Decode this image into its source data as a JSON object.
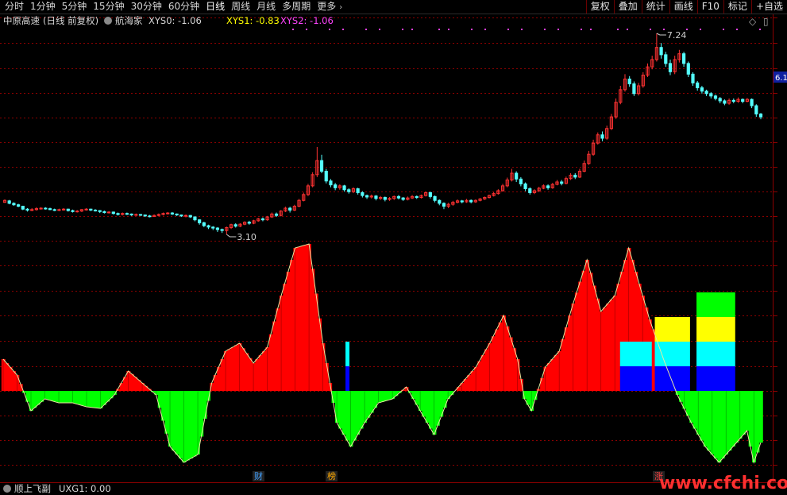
{
  "toolbar": {
    "periods": [
      {
        "label": "分时",
        "active": false
      },
      {
        "label": "1分钟",
        "active": false
      },
      {
        "label": "5分钟",
        "active": false
      },
      {
        "label": "15分钟",
        "active": false
      },
      {
        "label": "30分钟",
        "active": false
      },
      {
        "label": "60分钟",
        "active": false
      },
      {
        "label": "日线",
        "active": true
      },
      {
        "label": "周线",
        "active": false
      },
      {
        "label": "月线",
        "active": false
      },
      {
        "label": "多周期",
        "active": false
      },
      {
        "label": "更多",
        "active": false
      }
    ],
    "buttons": [
      "复权",
      "叠加",
      "统计",
      "画线",
      "F10",
      "标记",
      "+自选"
    ]
  },
  "info": {
    "stock_name": "中原高速",
    "mode": "(日线 前复权)",
    "indicator": "航海家",
    "xys0": "XYS0: -1.06",
    "xys1": "XYS1: -0.83",
    "xys2": "XYS2: -1.06"
  },
  "price_panel": {
    "high_label": "7.24",
    "low_label": "3.10",
    "right_price_tag": "6.1",
    "candles": [
      [
        3.76,
        3.8,
        3.82,
        3.75
      ],
      [
        3.79,
        3.74,
        3.81,
        3.72
      ],
      [
        3.74,
        3.71,
        3.76,
        3.69
      ],
      [
        3.71,
        3.68,
        3.73,
        3.66
      ],
      [
        3.68,
        3.62,
        3.69,
        3.6
      ],
      [
        3.62,
        3.6,
        3.64,
        3.57
      ],
      [
        3.6,
        3.61,
        3.64,
        3.58
      ],
      [
        3.61,
        3.63,
        3.66,
        3.59
      ],
      [
        3.63,
        3.64,
        3.66,
        3.61
      ],
      [
        3.64,
        3.63,
        3.66,
        3.61
      ],
      [
        3.63,
        3.61,
        3.65,
        3.6
      ],
      [
        3.61,
        3.6,
        3.63,
        3.58
      ],
      [
        3.6,
        3.61,
        3.63,
        3.58
      ],
      [
        3.61,
        3.62,
        3.64,
        3.59
      ],
      [
        3.62,
        3.59,
        3.63,
        3.57
      ],
      [
        3.59,
        3.57,
        3.61,
        3.55
      ],
      [
        3.57,
        3.58,
        3.6,
        3.55
      ],
      [
        3.58,
        3.61,
        3.62,
        3.56
      ],
      [
        3.61,
        3.62,
        3.64,
        3.59
      ],
      [
        3.62,
        3.6,
        3.63,
        3.58
      ],
      [
        3.6,
        3.59,
        3.62,
        3.57
      ],
      [
        3.59,
        3.57,
        3.6,
        3.54
      ],
      [
        3.57,
        3.55,
        3.59,
        3.53
      ],
      [
        3.55,
        3.56,
        3.58,
        3.53
      ],
      [
        3.56,
        3.53,
        3.57,
        3.51
      ],
      [
        3.53,
        3.51,
        3.55,
        3.49
      ],
      [
        3.51,
        3.53,
        3.55,
        3.49
      ],
      [
        3.53,
        3.52,
        3.55,
        3.5
      ],
      [
        3.52,
        3.5,
        3.53,
        3.48
      ],
      [
        3.5,
        3.51,
        3.53,
        3.48
      ],
      [
        3.51,
        3.5,
        3.52,
        3.48
      ],
      [
        3.5,
        3.48,
        3.51,
        3.46
      ],
      [
        3.48,
        3.47,
        3.5,
        3.45
      ],
      [
        3.47,
        3.49,
        3.51,
        3.46
      ],
      [
        3.49,
        3.51,
        3.53,
        3.47
      ],
      [
        3.51,
        3.53,
        3.55,
        3.49
      ],
      [
        3.53,
        3.54,
        3.56,
        3.51
      ],
      [
        3.54,
        3.52,
        3.56,
        3.5
      ],
      [
        3.52,
        3.5,
        3.53,
        3.48
      ],
      [
        3.5,
        3.48,
        3.51,
        3.46
      ],
      [
        3.48,
        3.49,
        3.51,
        3.45
      ],
      [
        3.49,
        3.46,
        3.5,
        3.44
      ],
      [
        3.46,
        3.4,
        3.47,
        3.37
      ],
      [
        3.4,
        3.34,
        3.41,
        3.3
      ],
      [
        3.34,
        3.28,
        3.36,
        3.25
      ],
      [
        3.28,
        3.25,
        3.3,
        3.21
      ],
      [
        3.25,
        3.23,
        3.27,
        3.19
      ],
      [
        3.23,
        3.2,
        3.25,
        3.15
      ],
      [
        3.2,
        3.18,
        3.22,
        3.13
      ],
      [
        3.18,
        3.24,
        3.26,
        3.1
      ],
      [
        3.24,
        3.3,
        3.32,
        3.21
      ],
      [
        3.3,
        3.27,
        3.33,
        3.24
      ],
      [
        3.27,
        3.31,
        3.33,
        3.25
      ],
      [
        3.31,
        3.35,
        3.37,
        3.29
      ],
      [
        3.35,
        3.33,
        3.38,
        3.3
      ],
      [
        3.33,
        3.38,
        3.4,
        3.31
      ],
      [
        3.38,
        3.42,
        3.44,
        3.36
      ],
      [
        3.42,
        3.4,
        3.45,
        3.37
      ],
      [
        3.4,
        3.46,
        3.48,
        3.38
      ],
      [
        3.46,
        3.52,
        3.55,
        3.44
      ],
      [
        3.52,
        3.49,
        3.55,
        3.46
      ],
      [
        3.49,
        3.58,
        3.6,
        3.47
      ],
      [
        3.58,
        3.64,
        3.67,
        3.56
      ],
      [
        3.64,
        3.6,
        3.67,
        3.55
      ],
      [
        3.6,
        3.68,
        3.71,
        3.58
      ],
      [
        3.68,
        3.8,
        3.83,
        3.66
      ],
      [
        3.8,
        3.92,
        3.96,
        3.78
      ],
      [
        3.92,
        4.1,
        4.14,
        3.89
      ],
      [
        4.1,
        4.33,
        4.38,
        4.07
      ],
      [
        4.33,
        4.62,
        4.9,
        4.28
      ],
      [
        4.62,
        4.4,
        4.74,
        4.36
      ],
      [
        4.4,
        4.2,
        4.45,
        4.15
      ],
      [
        4.2,
        4.12,
        4.24,
        4.07
      ],
      [
        4.12,
        4.06,
        4.16,
        4.01
      ],
      [
        4.06,
        4.1,
        4.13,
        4.02
      ],
      [
        4.1,
        4.02,
        4.12,
        3.98
      ],
      [
        4.02,
        3.98,
        4.05,
        3.94
      ],
      [
        3.98,
        4.04,
        4.07,
        3.95
      ],
      [
        4.04,
        3.96,
        4.06,
        3.92
      ],
      [
        3.96,
        3.9,
        3.99,
        3.86
      ],
      [
        3.9,
        3.87,
        3.92,
        3.83
      ],
      [
        3.87,
        3.89,
        3.92,
        3.84
      ],
      [
        3.89,
        3.84,
        3.91,
        3.8
      ],
      [
        3.84,
        3.86,
        3.89,
        3.81
      ],
      [
        3.86,
        3.82,
        3.88,
        3.78
      ],
      [
        3.82,
        3.84,
        3.87,
        3.79
      ],
      [
        3.84,
        3.88,
        3.9,
        3.81
      ],
      [
        3.88,
        3.85,
        3.91,
        3.82
      ],
      [
        3.85,
        3.82,
        3.87,
        3.79
      ],
      [
        3.82,
        3.85,
        3.88,
        3.8
      ],
      [
        3.85,
        3.88,
        3.91,
        3.83
      ],
      [
        3.88,
        3.86,
        3.9,
        3.83
      ],
      [
        3.86,
        3.9,
        3.92,
        3.84
      ],
      [
        3.9,
        3.96,
        3.98,
        3.88
      ],
      [
        3.96,
        3.88,
        3.98,
        3.84
      ],
      [
        3.88,
        3.8,
        3.9,
        3.76
      ],
      [
        3.8,
        3.74,
        3.82,
        3.7
      ],
      [
        3.74,
        3.68,
        3.76,
        3.62
      ],
      [
        3.68,
        3.72,
        3.75,
        3.64
      ],
      [
        3.72,
        3.76,
        3.79,
        3.69
      ],
      [
        3.76,
        3.79,
        3.82,
        3.74
      ],
      [
        3.79,
        3.77,
        3.81,
        3.74
      ],
      [
        3.77,
        3.8,
        3.83,
        3.75
      ],
      [
        3.8,
        3.77,
        3.82,
        3.74
      ],
      [
        3.77,
        3.8,
        3.82,
        3.75
      ],
      [
        3.8,
        3.83,
        3.85,
        3.78
      ],
      [
        3.83,
        3.86,
        3.88,
        3.81
      ],
      [
        3.86,
        3.9,
        3.92,
        3.84
      ],
      [
        3.9,
        3.94,
        3.97,
        3.88
      ],
      [
        3.94,
        4.0,
        4.03,
        3.92
      ],
      [
        4.0,
        4.1,
        4.14,
        3.98
      ],
      [
        4.1,
        4.22,
        4.27,
        4.07
      ],
      [
        4.22,
        4.36,
        4.45,
        4.19
      ],
      [
        4.36,
        4.24,
        4.4,
        4.18
      ],
      [
        4.24,
        4.14,
        4.28,
        4.09
      ],
      [
        4.14,
        4.04,
        4.17,
        3.99
      ],
      [
        4.04,
        3.96,
        4.07,
        3.92
      ],
      [
        3.96,
        4.0,
        4.03,
        3.93
      ],
      [
        4.0,
        4.05,
        4.08,
        3.97
      ],
      [
        4.05,
        4.1,
        4.13,
        4.03
      ],
      [
        4.1,
        4.06,
        4.13,
        4.02
      ],
      [
        4.06,
        4.13,
        4.16,
        4.04
      ],
      [
        4.13,
        4.18,
        4.22,
        4.11
      ],
      [
        4.18,
        4.15,
        4.22,
        4.11
      ],
      [
        4.15,
        4.25,
        4.29,
        4.13
      ],
      [
        4.25,
        4.32,
        4.36,
        4.22
      ],
      [
        4.32,
        4.28,
        4.36,
        4.24
      ],
      [
        4.28,
        4.4,
        4.45,
        4.26
      ],
      [
        4.4,
        4.56,
        4.62,
        4.38
      ],
      [
        4.56,
        4.75,
        4.82,
        4.53
      ],
      [
        4.75,
        4.98,
        5.05,
        4.72
      ],
      [
        4.98,
        5.15,
        5.2,
        4.95
      ],
      [
        5.15,
        5.08,
        5.22,
        5.02
      ],
      [
        5.08,
        5.28,
        5.34,
        5.05
      ],
      [
        5.28,
        5.52,
        5.58,
        5.25
      ],
      [
        5.52,
        5.82,
        5.9,
        5.48
      ],
      [
        5.82,
        6.08,
        6.16,
        5.78
      ],
      [
        6.08,
        6.3,
        6.4,
        6.04
      ],
      [
        6.3,
        6.2,
        6.36,
        6.14
      ],
      [
        6.2,
        6.0,
        6.25,
        5.95
      ],
      [
        6.0,
        6.16,
        6.22,
        5.96
      ],
      [
        6.16,
        6.38,
        6.44,
        6.12
      ],
      [
        6.38,
        6.55,
        6.62,
        6.34
      ],
      [
        6.55,
        6.7,
        6.78,
        6.5
      ],
      [
        6.7,
        6.95,
        7.24,
        6.66
      ],
      [
        6.95,
        6.8,
        7.04,
        6.72
      ],
      [
        6.8,
        6.62,
        6.86,
        6.55
      ],
      [
        6.62,
        6.45,
        6.7,
        6.38
      ],
      [
        6.45,
        6.7,
        6.78,
        6.4
      ],
      [
        6.7,
        6.82,
        6.9,
        6.64
      ],
      [
        6.82,
        6.62,
        6.86,
        6.55
      ],
      [
        6.62,
        6.4,
        6.66,
        6.34
      ],
      [
        6.4,
        6.22,
        6.44,
        6.16
      ],
      [
        6.22,
        6.12,
        6.26,
        6.06
      ],
      [
        6.12,
        6.05,
        6.16,
        6.0
      ],
      [
        6.05,
        6.0,
        6.08,
        5.95
      ],
      [
        6.0,
        5.95,
        6.03,
        5.9
      ],
      [
        5.95,
        5.9,
        5.98,
        5.86
      ],
      [
        5.9,
        5.85,
        5.93,
        5.8
      ],
      [
        5.85,
        5.8,
        5.88,
        5.76
      ],
      [
        5.8,
        5.86,
        5.9,
        5.77
      ],
      [
        5.86,
        5.84,
        5.9,
        5.8
      ],
      [
        5.84,
        5.88,
        5.92,
        5.81
      ],
      [
        5.88,
        5.84,
        5.9,
        5.8
      ],
      [
        5.84,
        5.88,
        5.91,
        5.82
      ],
      [
        5.88,
        5.75,
        5.9,
        5.7
      ],
      [
        5.75,
        5.58,
        5.78,
        5.52
      ],
      [
        5.58,
        5.52,
        5.6,
        5.47
      ]
    ]
  },
  "indicator_panel": {
    "name": "顺上飞副",
    "value_label": "UXG1: 0.00",
    "markers": [
      {
        "text": "财",
        "color": "#40a0ff"
      },
      {
        "text": "榜",
        "color": "#ffaa00"
      },
      {
        "text": "涨",
        "color": "#ff4040"
      }
    ],
    "osc_keypoints": [
      [
        0,
        40
      ],
      [
        4,
        20
      ],
      [
        8,
        -25
      ],
      [
        12,
        -10
      ],
      [
        16,
        -15
      ],
      [
        20,
        -15
      ],
      [
        24,
        -20
      ],
      [
        28,
        -22
      ],
      [
        32,
        -5
      ],
      [
        36,
        25
      ],
      [
        40,
        10
      ],
      [
        44,
        -5
      ],
      [
        48,
        -70
      ],
      [
        52,
        -90
      ],
      [
        56,
        -80
      ],
      [
        60,
        10
      ],
      [
        64,
        50
      ],
      [
        68,
        60
      ],
      [
        72,
        35
      ],
      [
        76,
        55
      ],
      [
        80,
        120
      ],
      [
        84,
        180
      ],
      [
        88,
        185
      ],
      [
        92,
        60
      ],
      [
        96,
        -40
      ],
      [
        100,
        -70
      ],
      [
        104,
        -40
      ],
      [
        108,
        -15
      ],
      [
        112,
        -10
      ],
      [
        116,
        5
      ],
      [
        120,
        -25
      ],
      [
        124,
        -55
      ],
      [
        128,
        -10
      ],
      [
        132,
        10
      ],
      [
        136,
        30
      ],
      [
        140,
        60
      ],
      [
        144,
        95
      ],
      [
        148,
        40
      ],
      [
        150,
        -10
      ],
      [
        152,
        -25
      ],
      [
        156,
        30
      ],
      [
        160,
        50
      ],
      [
        164,
        110
      ],
      [
        168,
        165
      ],
      [
        172,
        100
      ],
      [
        176,
        120
      ],
      [
        180,
        180
      ],
      [
        184,
        120
      ],
      [
        186,
        90
      ],
      [
        190,
        40
      ],
      [
        194,
        -5
      ],
      [
        198,
        -40
      ],
      [
        202,
        -70
      ],
      [
        206,
        -90
      ],
      [
        210,
        -70
      ],
      [
        214,
        -50
      ],
      [
        216,
        -90
      ],
      [
        218,
        -65
      ]
    ],
    "blocks": [
      {
        "from": 99,
        "to": 99,
        "levels": [
          1,
          1,
          0,
          0
        ]
      },
      {
        "from": 178,
        "to": 186,
        "levels": [
          1,
          1,
          0,
          0
        ]
      },
      {
        "from": 188,
        "to": 197,
        "levels": [
          1,
          1,
          1,
          0
        ]
      },
      {
        "from": 200,
        "to": 210,
        "levels": [
          1,
          1,
          1,
          1
        ]
      },
      {
        "from": 205,
        "to": 208,
        "levels": [
          0,
          0,
          0,
          1
        ]
      }
    ]
  },
  "watermark": "www.cfchi.com",
  "colors": {
    "up": "#ff3232",
    "down": "#54ffff",
    "grid": "#8c0000",
    "osc_pos": "#ff0000",
    "osc_neg": "#00ff00",
    "osc_line": "#e8e8a0",
    "info_xys1": "#ffff00",
    "info_xys2": "#ff44ff",
    "watermark": "#ff3030",
    "block_blue": "#0000ff",
    "block_cyan": "#00ffff",
    "block_yellow": "#ffff00",
    "block_green": "#00ff00"
  }
}
